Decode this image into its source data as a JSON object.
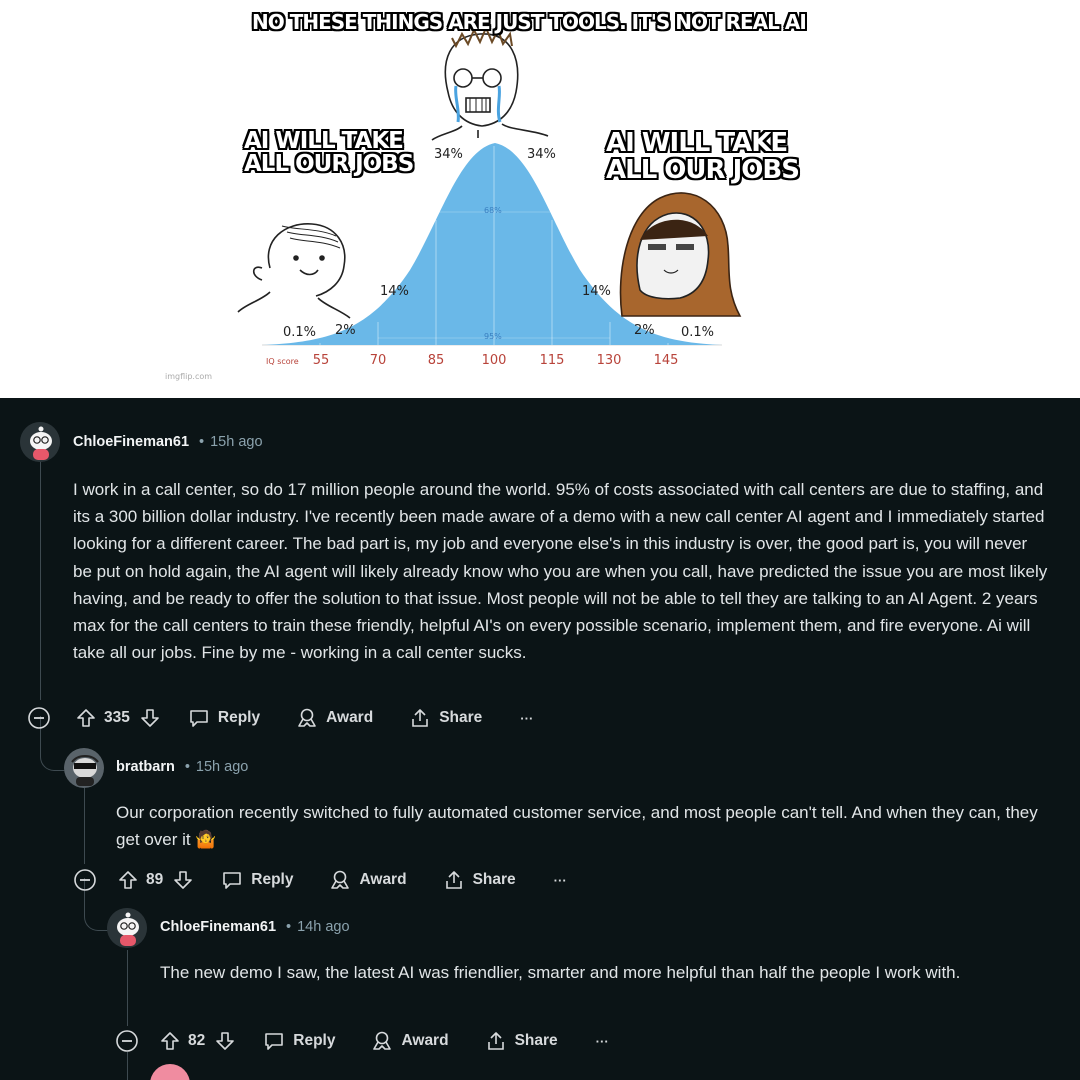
{
  "meme": {
    "top_caption": "NO THESE THINGS ARE JUST TOOLS. IT'S NOT REAL AI",
    "left_caption_line1": "AI WILL TAKE",
    "left_caption_line2": "ALL OUR JOBS",
    "right_caption_line1": "AI WILL TAKE",
    "right_caption_line2": "ALL OUR JOBS",
    "percentages": {
      "far_left": "0.1%",
      "left_2": "2%",
      "left_14": "14%",
      "left_34": "34%",
      "right_34": "34%",
      "right_14": "14%",
      "right_2": "2%",
      "far_right": "0.1%",
      "inner_68": "68%",
      "inner_95": "95%"
    },
    "iq_label": "IQ score",
    "iq_ticks": [
      "55",
      "70",
      "85",
      "100",
      "115",
      "130",
      "145"
    ],
    "watermark": "imgflip.com",
    "curve_color": "#6ab8e8",
    "caption_fill": "#ffffff",
    "caption_outline": "#000000"
  },
  "comments": [
    {
      "author": "ChloeFineman61",
      "time": "15h ago",
      "text": "I work in a call center, so do 17 million people around the world. 95% of costs associated with call centers are due to staffing, and its a 300 billion dollar industry. I've recently been made aware of a demo with a new call center AI agent and I immediately started looking for a different career. The bad part is, my job and everyone else's in this industry is over, the good part is, you will never be put on hold again, the AI agent will likely already know who you are when you call, have predicted the issue you are most likely having, and be ready to offer the solution to that issue. Most people will not be able to tell they are talking to an AI Agent. 2 years max for the call centers to train these friendly, helpful AI's on every possible scenario, implement them, and fire everyone. Ai will take all our jobs. Fine by me - working in a call center sucks.",
      "votes": "335",
      "reply_label": "Reply",
      "award_label": "Award",
      "share_label": "Share",
      "more_label": "···"
    },
    {
      "author": "bratbarn",
      "time": "15h ago",
      "text": "Our corporation recently switched to fully automated customer service, and most people can't tell. And when they can, they get over it 🤷",
      "votes": "89",
      "reply_label": "Reply",
      "award_label": "Award",
      "share_label": "Share",
      "more_label": "···"
    },
    {
      "author": "ChloeFineman61",
      "time": "14h ago",
      "text": "The new demo I saw, the latest AI was friendlier, smarter and more helpful than half the people I work with.",
      "votes": "82",
      "reply_label": "Reply",
      "award_label": "Award",
      "share_label": "Share",
      "more_label": "···"
    }
  ],
  "separator": "•",
  "colors": {
    "thread_bg": "#0b1416",
    "text": "#e1e5e7",
    "meta_gray": "#8ba2ad",
    "thread_line": "#3e4a50"
  },
  "icons": [
    "collapse-icon",
    "upvote-icon",
    "downvote-icon",
    "reply-icon",
    "award-icon",
    "share-icon",
    "more-icon"
  ]
}
